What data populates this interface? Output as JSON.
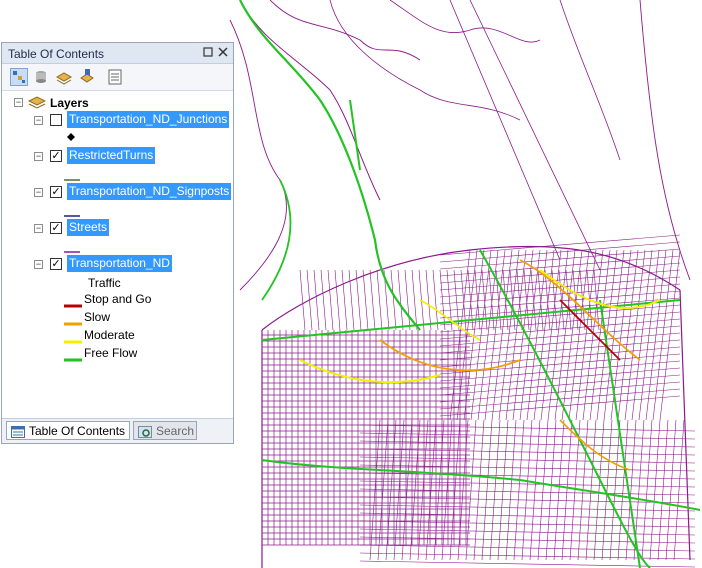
{
  "toc": {
    "title": "Table Of Contents",
    "toolbar": [
      "list-by-drawing-order-icon",
      "list-by-source-icon",
      "list-by-visibility-icon",
      "list-by-selection-icon",
      "options-icon"
    ],
    "root_label": "Layers",
    "layers": [
      {
        "name": "Transportation_ND_Junctions",
        "checked": false,
        "symbol": "point"
      },
      {
        "name": "RestrictedTurns",
        "checked": true,
        "symbol": "line-olive"
      },
      {
        "name": "Transportation_ND_Signposts",
        "checked": true,
        "symbol": "line-navy"
      },
      {
        "name": "Streets",
        "checked": true,
        "symbol": "line-purple"
      },
      {
        "name": "Transportation_ND",
        "checked": true,
        "symbol": "legend"
      }
    ],
    "traffic_heading": "Traffic",
    "legend": [
      {
        "label": "Stop and Go",
        "color": "#b40000"
      },
      {
        "label": "Slow",
        "color": "#f0a000"
      },
      {
        "label": "Moderate",
        "color": "#f0f000"
      },
      {
        "label": "Free Flow",
        "color": "#22c322"
      }
    ],
    "tabs": {
      "contents": "Table Of Contents",
      "search": "Search"
    }
  },
  "map": {
    "street_color": "#8b1a8b",
    "colors": {
      "free_flow": "#22c322",
      "slow": "#f0a000",
      "moderate": "#f0f000",
      "stop_and_go": "#b40000"
    }
  }
}
